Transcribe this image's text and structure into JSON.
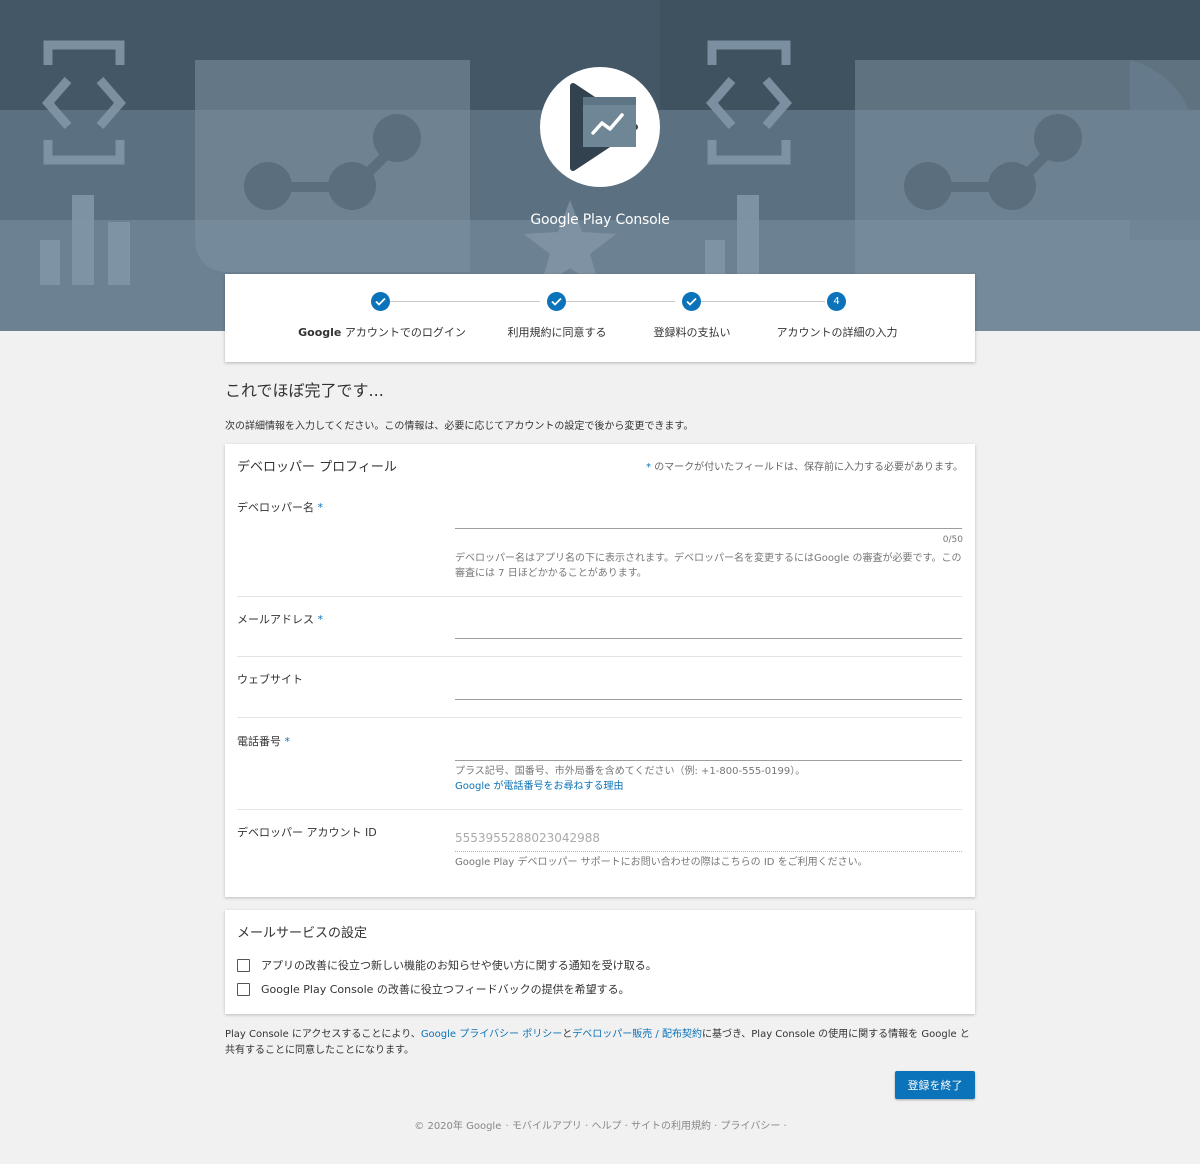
{
  "brand": {
    "logo_text": "Google Play Console"
  },
  "stepper": {
    "steps": [
      {
        "prefix": "Google",
        "label": " アカウントでのログイン",
        "state": "done"
      },
      {
        "prefix": "",
        "label": "利用規約に同意する",
        "state": "done"
      },
      {
        "prefix": "",
        "label": "登録料の支払い",
        "state": "done"
      },
      {
        "prefix": "",
        "label": "アカウントの詳細の入力",
        "state": "current",
        "number": "4"
      }
    ]
  },
  "heading": "これでほぼ完了です...",
  "intro": "次の詳細情報を入力してください。この情報は、必要に応じてアカウントの設定で後から変更できます。",
  "profile": {
    "title": "デベロッパー プロフィール",
    "required_note": "のマークが付いたフィールドは、保存前に入力する必要があります。",
    "required_star": "*",
    "developer_name": {
      "label": "デベロッパー名",
      "counter": "0/50",
      "helper": "デベロッパー名はアプリ名の下に表示されます。デベロッパー名を変更するにはGoogle の審査が必要です。この審査には 7 日ほどかかることがあります。"
    },
    "email": {
      "label": "メールアドレス"
    },
    "website": {
      "label": "ウェブサイト"
    },
    "phone": {
      "label": "電話番号",
      "helper": "プラス記号、国番号、市外局番を含めてください（例: +1-800-555-0199）。",
      "link": "Google が電話番号をお尋ねする理由"
    },
    "account_id": {
      "label": "デベロッパー アカウント ID",
      "value": "5553955288023042988",
      "helper": "Google Play デベロッパー サポートにお問い合わせの際はこちらの ID をご利用ください。"
    }
  },
  "mail": {
    "title": "メールサービスの設定",
    "options": [
      {
        "label": "アプリの改善に役立つ新しい機能のお知らせや使い方に関する通知を受け取る。",
        "checked": false
      },
      {
        "label": "Google Play Console の改善に役立つフィードバックの提供を希望する。",
        "checked": false
      }
    ]
  },
  "consent": {
    "part1": "Play Console にアクセスすることにより、",
    "link1": "Google プライバシー ポリシー",
    "part2": "と",
    "link2": "デベロッパー販売 / 配布契約",
    "part3": "に基づき、Play Console の使用に関する情報を Google と共有することに同意したことになります。"
  },
  "finish_button": "登録を終了",
  "footer": {
    "copyright": "© 2020年 Google",
    "links": [
      "モバイルアプリ",
      "ヘルプ",
      "サイトの利用規約",
      "プライバシー"
    ]
  },
  "colors": {
    "accent": "#0b73b9",
    "hero": "#62788a"
  }
}
